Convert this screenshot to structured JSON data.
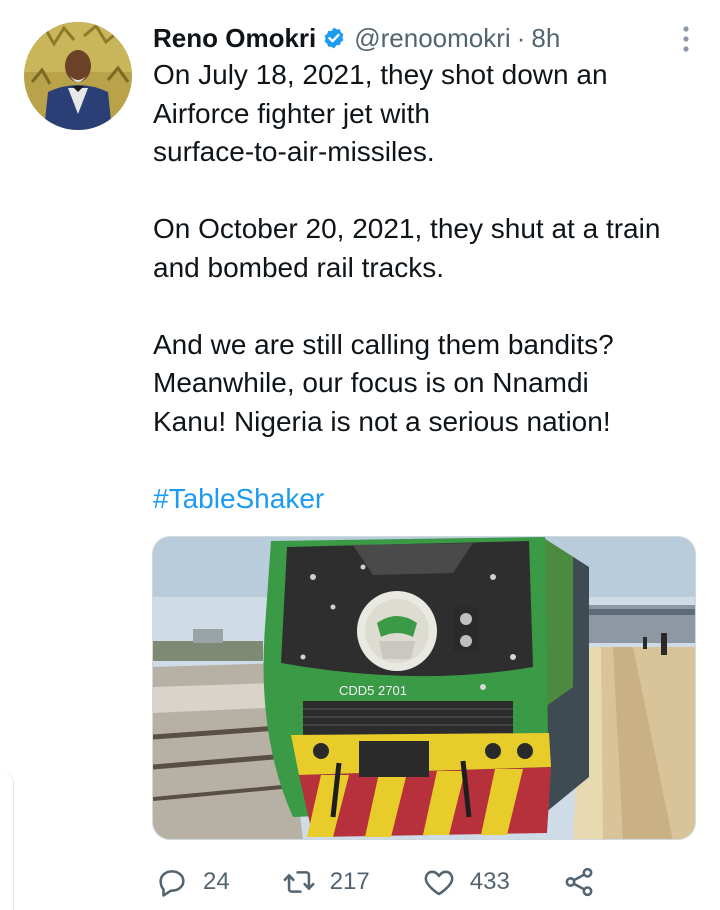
{
  "tweet": {
    "author_name": "Reno Omokri",
    "handle": "@renoomokri",
    "separator": "·",
    "time": "8h",
    "lines": [
      "On July 18, 2021, they shot down an",
      "Airforce fighter jet with",
      "surface-to-air-missiles."
    ],
    "lines2": [
      "On October 20, 2021, they shut at a train",
      "and bombed rail tracks."
    ],
    "lines3": [
      "And we are still calling them bandits?",
      "Meanwhile, our focus is on Nnamdi",
      "Kanu! Nigeria is not a serious nation!"
    ],
    "hashtag": "#TableShaker",
    "train_number": "CDD5  2701"
  },
  "actions": {
    "replies": "24",
    "retweets": "217",
    "likes": "433"
  },
  "icons": {
    "verified": "verified-badge-icon",
    "more": "more-vertical-icon",
    "reply": "reply-icon",
    "retweet": "retweet-icon",
    "like": "heart-icon",
    "share": "share-icon"
  },
  "colors": {
    "accent": "#1d9bf0",
    "text": "#0f1419",
    "muted": "#536471"
  }
}
